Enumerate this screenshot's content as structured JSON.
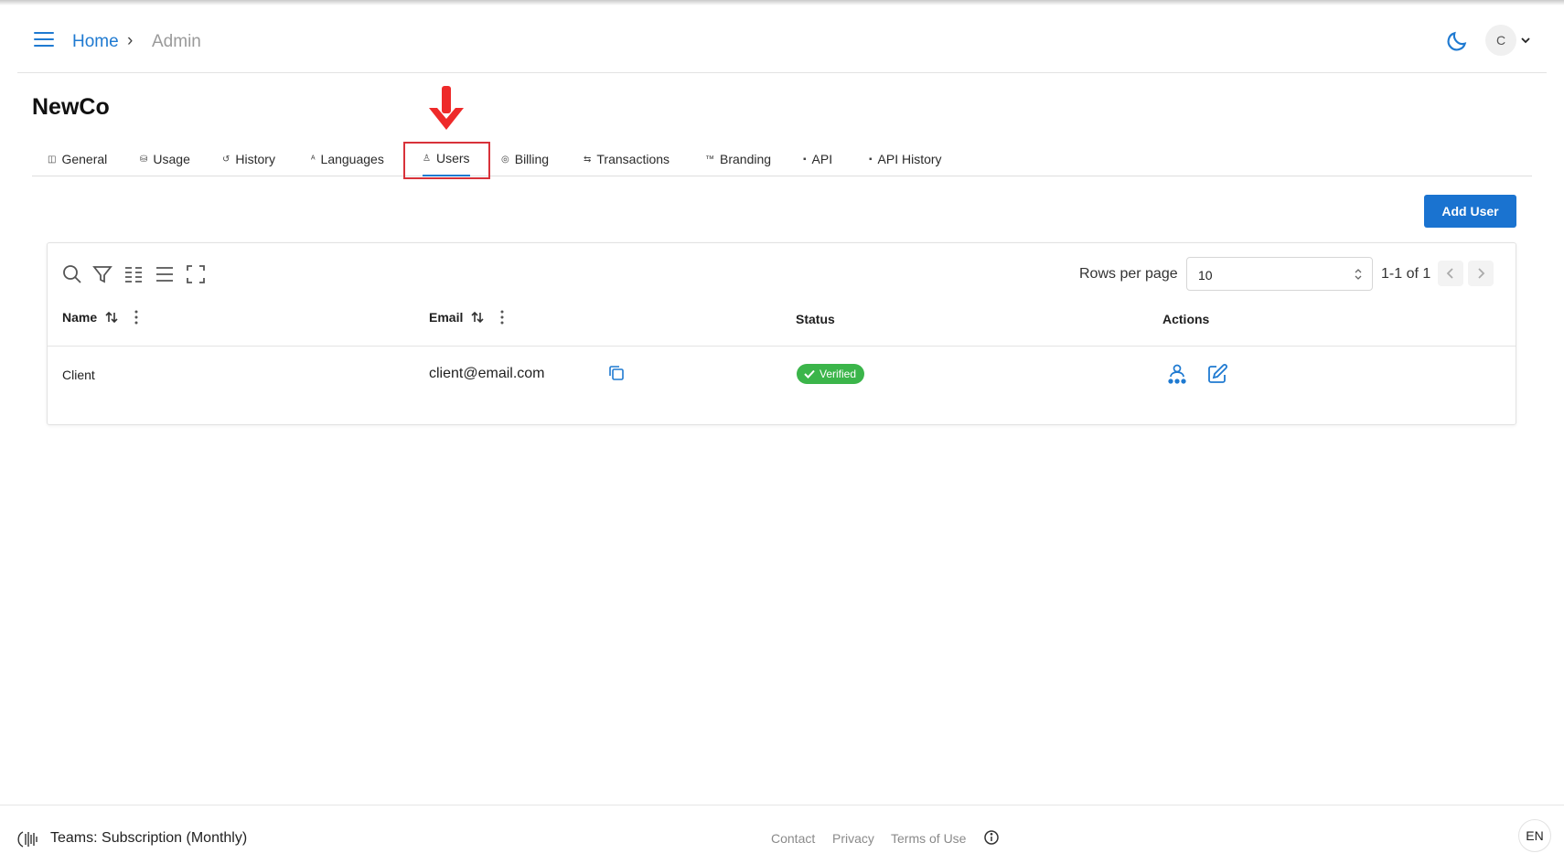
{
  "header": {
    "breadcrumb": {
      "home": "Home",
      "current": "Admin"
    },
    "avatar_initial": "C"
  },
  "organization": {
    "name": "NewCo"
  },
  "tabs": [
    {
      "label": "General",
      "icon": "info-square-icon"
    },
    {
      "label": "Usage",
      "icon": "cylinder-icon"
    },
    {
      "label": "History",
      "icon": "history-icon"
    },
    {
      "label": "Languages",
      "icon": "translate-icon"
    },
    {
      "label": "Users",
      "icon": "user-icon",
      "active": true
    },
    {
      "label": "Billing",
      "icon": "coins-icon"
    },
    {
      "label": "Transactions",
      "icon": "exchange-icon"
    },
    {
      "label": "Branding",
      "icon": "trademark-icon"
    },
    {
      "label": "API",
      "icon": "api-icon"
    },
    {
      "label": "API History",
      "icon": "api-icon"
    }
  ],
  "actions": {
    "add_user": "Add User"
  },
  "table": {
    "rows_per_page_label": "Rows per page",
    "rows_per_page_value": "10",
    "page_info": "1-1 of 1",
    "columns": {
      "name": "Name",
      "email": "Email",
      "status": "Status",
      "actions": "Actions"
    },
    "rows": [
      {
        "name": "Client",
        "email": "client@email.com",
        "status": "Verified"
      }
    ]
  },
  "footer": {
    "plan": "Teams: Subscription (Monthly)",
    "links": {
      "contact": "Contact",
      "privacy": "Privacy",
      "terms": "Terms of Use"
    },
    "language": "EN"
  },
  "colors": {
    "accent": "#1a73d0",
    "verified": "#3bb54a",
    "annotation": "#d8323a"
  }
}
